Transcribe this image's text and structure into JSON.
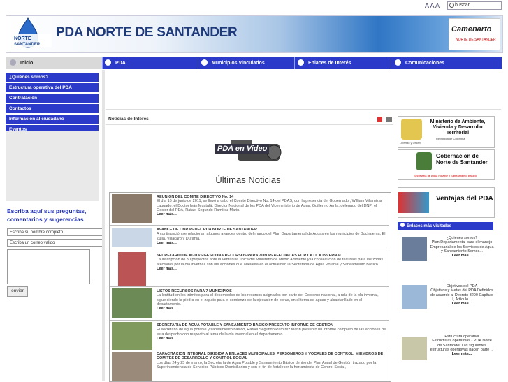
{
  "topbar": {
    "font_sizer": "A A A",
    "search_placeholder": "buscar..."
  },
  "header": {
    "logo_text": "PDA NORTE DE SANTANDER",
    "title": "PDA NORTE DE SANTANDER",
    "brand": "Camenarto",
    "brand_sub": "NORTE DE SANTANDER"
  },
  "nav": {
    "items": [
      {
        "label": "Inicio",
        "icon": "home-icon"
      },
      {
        "label": "PDA",
        "icon": "drop-icon"
      },
      {
        "label": "Municipios Vinculados",
        "icon": "people-icon"
      },
      {
        "label": "Enlaces de Interés",
        "icon": "link-icon"
      },
      {
        "label": "Comunicaciones",
        "icon": "globe-icon"
      }
    ]
  },
  "left_menu": {
    "items": [
      "¿Quiénes somos?",
      "Estructura operativa del PDA",
      "Contratación",
      "Contactos",
      "Información al ciudadano",
      "Eventos"
    ]
  },
  "contact_form": {
    "title": "Escriba aquí sus preguntas, comentarios y sugerencias",
    "name_value": "Escriba su nombre completo",
    "email_value": "Escriba un correo valido",
    "submit_label": "enviar"
  },
  "main": {
    "section_label": "Noticias de Interés",
    "video_label": "PDA en Video",
    "heading": "Últimas Noticias",
    "news": [
      {
        "title": "REUNION DEL COMITE DIRECTIVO No. 14",
        "body": "El día 16 de junio de 2011, se llevó a cabo el Comité Directivo No. 14 del PDAS, con la presencia del Gobernador, William Villamizar Laguado; el Doctor Iván Mustafá, Director Nacional de los PDA del Viceministerio de Agua; Guillermo Arrila, delegado del DNP; el Gestor del PDA, Rafael Segundo Ramírez Marin.",
        "more": "Leer más..."
      },
      {
        "title": "AVANCE DE OBRAS DEL PDA NORTE DE SANTANDER",
        "body": "A continuación se relacionan algunos avances dentro del marco del Plan Departamental de Aguas en los municipios de Bochalema, El Zulia, Villacaro y Durania.",
        "more": "Leer más..."
      },
      {
        "title": "SECRETARIO DE AGUAS GESTIONA RECURSOS PARA ZONAS AFECTADAS POR LA OLA INVERNAL",
        "body": "La inscripción de 30 proyectos ante la ventanilla única del Ministerio de Medio Ambiente y la consecución de recursos para las zonas afectadas por la ola invernal, son las acciones que adelanta en el actualidad la Secretaría de Agua Potable y Saneamiento Básico.",
        "more": "Leer más..."
      },
      {
        "title": "LISTOS RECURSOS PARA 7 MUNICIPIOS",
        "body": "La lentitud en los trámites para el desembolso de los recursos asignados por parte del Gobierno nacional, a raíz de la ola invernal, sigue siendo la piedra en el zapato para el comienzo de la ejecución de obras, en el tema de aguas y alcantarillado en el departamento.",
        "more": "Leer más..."
      },
      {
        "title": "SECRETARIA DE AGUA POTABLE Y SANEAMIENTO BASICO PRESENTO INFORME DE GESTION",
        "body": "El secretario de agua potable y saneamiento básico, Rafael Segundo Ramírez Marín presentó un informe completo de las acciones de esta despacho con respecto al tema de la ola invernal en el departamento.",
        "more": "Leer más..."
      },
      {
        "title": "CAPACITACION INTEGRAL DIRIGIDA A ENLACES MUNICIPALES, PERSONEROS Y VOCALES DE CONTROL, MIEMBROS DE COMITES DE DESARROLLO Y CONTROL SOCIAL",
        "body": "Los días 24 y 25 de marzo, la Secretaría de Agua Potable y Saneamiento Básico dentro del Plan Anual de Gestión trazado por la Superintendencia de Servicios Públicos Domiciliarios y con el fin de fortalecer la herramienta de Control Social,",
        "more": "Leer más..."
      }
    ]
  },
  "right": {
    "ministerio": "Ministerio de Ambiente, Vivienda y Desarrollo Territorial",
    "ministerio_sub": "República de Colombia",
    "ministerio_motto": "Libertad y Orden",
    "gobernacion": "Gobernación de Norte de Santander",
    "gobernacion_sub": "Secretaría de Agua Potable y Saneamiento Básico",
    "ventajas": "Ventajas del PDA",
    "enlaces_title": "Enlaces más visitados",
    "links": [
      {
        "title": "¿Quienes somos?",
        "body": "Plan Departamental para el manejo Empresarial de los Servicios de Agua y Saneamiento Somos...",
        "more": "Leer más..."
      },
      {
        "title": "Objetivos del PDA",
        "body": "Objetivos y Metas del PDA Definidos de acuerdo al Decreto 3200 Capítulo I, Artículo...",
        "more": "Leer más..."
      },
      {
        "title": "Estructura operativa",
        "body": "Estructuras operativas - PDA Norte de Santander Las siguientes estructuras operativas hacen parte ...",
        "more": "Leer más..."
      }
    ]
  }
}
